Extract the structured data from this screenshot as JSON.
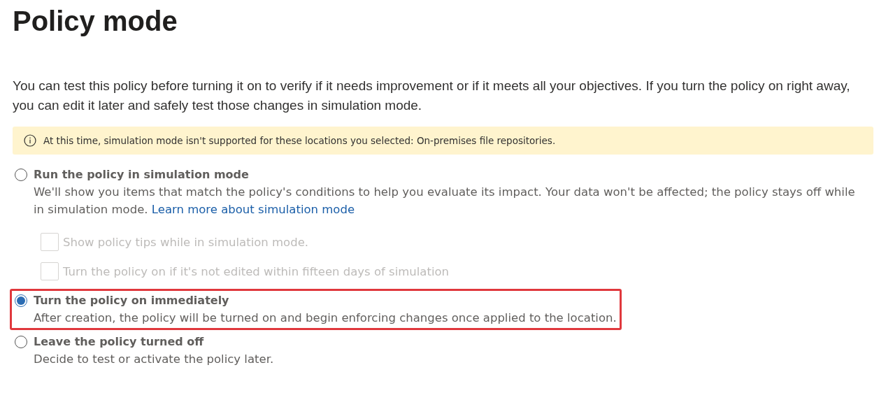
{
  "title": "Policy mode",
  "intro": "You can test this policy before turning it on to verify if it needs improvement or if it meets all your objectives. If you turn the policy on right away, you can edit it later and safely test those changes in simulation mode.",
  "notice": {
    "text": "At this time, simulation mode isn't supported for these locations you selected: On-premises file repositories."
  },
  "options": [
    {
      "label": "Run the policy in simulation mode",
      "selected": false,
      "highlighted": false,
      "description": "We'll show you items that match the policy's conditions to help you evaluate its impact. Your data won't be affected; the policy stays off while in simulation mode.",
      "link": "Learn more about simulation mode",
      "suboptions": [
        {
          "label": "Show policy tips while in simulation mode.",
          "checked": false,
          "disabled": true
        },
        {
          "label": "Turn the policy on if it's not edited within fifteen days of simulation",
          "checked": false,
          "disabled": true
        }
      ]
    },
    {
      "label": "Turn the policy on immediately",
      "selected": true,
      "highlighted": true,
      "description": "After creation, the policy will be turned on and begin enforcing changes once applied to the location."
    },
    {
      "label": "Leave the policy turned off",
      "selected": false,
      "highlighted": false,
      "description": "Decide to test or activate the policy later."
    }
  ]
}
